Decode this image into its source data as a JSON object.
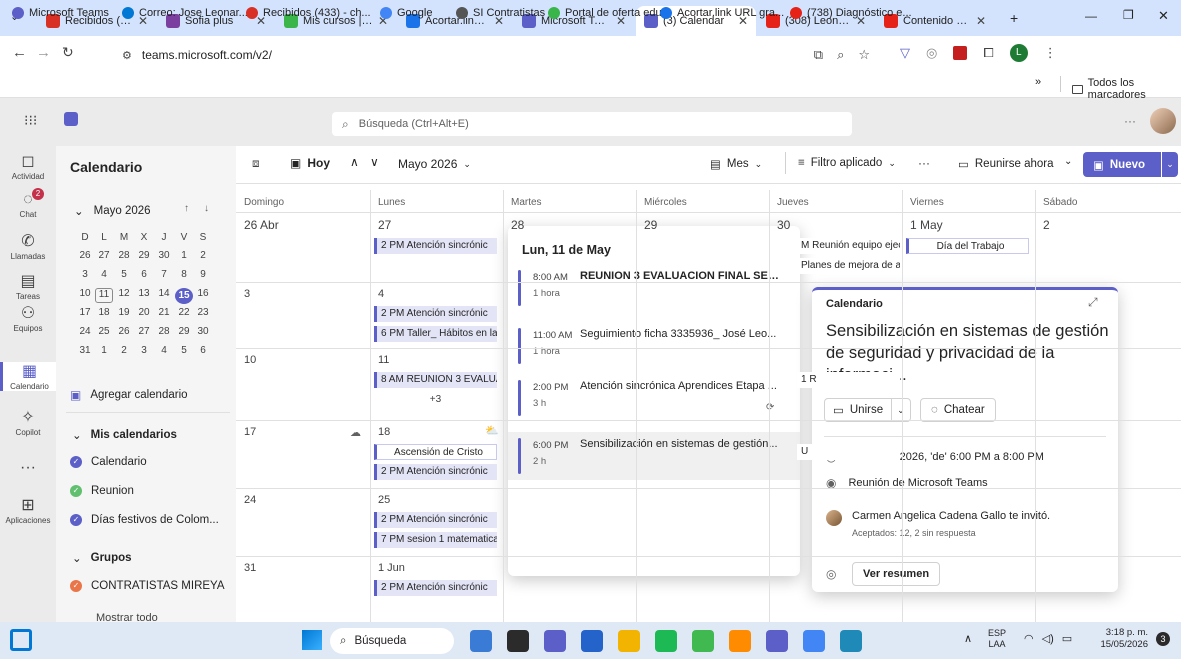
{
  "browser": {
    "tabs": [
      {
        "label": "Recibidos (3…",
        "color": "#d93025"
      },
      {
        "label": "Sofia plus",
        "color": "#7b3fa0"
      },
      {
        "label": "Mis cursos |…",
        "color": "#39b54a"
      },
      {
        "label": "Acortar.link…",
        "color": "#1a73e8"
      },
      {
        "label": "Microsoft Te…",
        "color": "#5b5fc7"
      },
      {
        "label": "(3) Calendar",
        "color": "#5b5fc7"
      },
      {
        "label": "(308) Leonar…",
        "color": "#e62117"
      },
      {
        "label": "Contenido d…",
        "color": "#e62117"
      }
    ],
    "new_tab": "+",
    "url": "teams.microsoft.com/v2/",
    "bookmarks": [
      {
        "label": "Microsoft Teams",
        "color": "#5b5fc7"
      },
      {
        "label": "Correo: Jose Leonar...",
        "color": "#0078d4"
      },
      {
        "label": "Recibidos (433) - ch...",
        "color": "#d93025"
      },
      {
        "label": "Google",
        "color": "#4285f4"
      },
      {
        "label": "SI Contratistas",
        "color": "#555555"
      },
      {
        "label": "Portal de oferta edu...",
        "color": "#39b54a"
      },
      {
        "label": "Acortar.link URL gra...",
        "color": "#1a73e8"
      },
      {
        "label": "(738) Diagnóstico e...",
        "color": "#e62117"
      }
    ],
    "bookmarks_more": "»",
    "all_bookmarks": "Todos los marcadores"
  },
  "teams": {
    "search_placeholder": "Búsqueda (Ctrl+Alt+E)",
    "more": "···",
    "rail": [
      {
        "label": "Actividad",
        "icon": "bell-icon"
      },
      {
        "label": "Chat",
        "icon": "chat-icon",
        "badge": "2"
      },
      {
        "label": "Llamadas",
        "icon": "phone-icon"
      },
      {
        "label": "Tareas",
        "icon": "tasks-icon"
      },
      {
        "label": "Equipos",
        "icon": "teams-icon"
      },
      {
        "label": "Calendario",
        "icon": "calendar-icon"
      },
      {
        "label": "Copilot",
        "icon": "copilot-icon"
      },
      {
        "label": "···",
        "icon": "more-icon"
      },
      {
        "label": "Aplicaciones",
        "icon": "apps-icon"
      }
    ]
  },
  "leftpanel": {
    "title": "Calendario",
    "month": "Mayo 2026",
    "weekdays": [
      "D",
      "L",
      "M",
      "X",
      "J",
      "V",
      "S"
    ],
    "weeks": [
      [
        "26",
        "27",
        "28",
        "29",
        "30",
        "1",
        "2"
      ],
      [
        "3",
        "4",
        "5",
        "6",
        "7",
        "8",
        "9"
      ],
      [
        "10",
        "11",
        "12",
        "13",
        "14",
        "15",
        "16"
      ],
      [
        "17",
        "18",
        "19",
        "20",
        "21",
        "22",
        "23"
      ],
      [
        "24",
        "25",
        "26",
        "27",
        "28",
        "29",
        "30"
      ],
      [
        "31",
        "1",
        "2",
        "3",
        "4",
        "5",
        "6"
      ]
    ],
    "add_calendar": "Agregar calendario",
    "my_calendars": "Mis calendarios",
    "calendars": [
      {
        "label": "Calendario",
        "color": "#5b5fc7"
      },
      {
        "label": "Reunion",
        "color": "#61c06f"
      },
      {
        "label": "Días festivos de Colom...",
        "color": "#5b5fc7"
      }
    ],
    "groups": "Grupos",
    "group_items": [
      {
        "label": "CONTRATISTAS MIREYA",
        "color": "#e97548"
      }
    ],
    "show_all": "Mostrar todo"
  },
  "cmdbar": {
    "today": "Hoy",
    "month_label": "Mayo 2026",
    "view": "Mes",
    "filter": "Filtro aplicado",
    "more": "···",
    "meet_now": "Reunirse ahora",
    "new": "Nuevo"
  },
  "grid": {
    "days": [
      "Domingo",
      "Lunes",
      "Martes",
      "Miércoles",
      "Jueves",
      "Viernes",
      "Sábado"
    ],
    "rows": [
      {
        "nums": [
          "26 Abr",
          "27",
          "28",
          "29",
          "30",
          "1 May",
          "2"
        ],
        "events": [
          {
            "col": 1,
            "slot": 0,
            "text": "2 PM Atención sincrónic"
          },
          {
            "col": 4,
            "slot": 0,
            "text": "M Reunión equipo ejec"
          },
          {
            "col": 4,
            "slot": 1,
            "text": "Planes de mejora de a"
          },
          {
            "col": 5,
            "slot": 0,
            "text": "Día del Trabajo",
            "allday": true
          }
        ]
      },
      {
        "nums": [
          "3",
          "4",
          "",
          "",
          "",
          "",
          ""
        ],
        "events": [
          {
            "col": 1,
            "slot": 0,
            "text": "2 PM Atención sincrónic"
          },
          {
            "col": 1,
            "slot": 1,
            "text": "6 PM Taller_ Hábitos en la F"
          }
        ]
      },
      {
        "nums": [
          "10",
          "11",
          "",
          "",
          "",
          "",
          ""
        ],
        "events": [
          {
            "col": 1,
            "slot": 0,
            "text": "8 AM REUNION 3 EVALUAC"
          },
          {
            "col": 4,
            "slot": 0,
            "text": "1 R"
          }
        ],
        "more": "+3"
      },
      {
        "nums": [
          "17",
          "18",
          "",
          "",
          "",
          "",
          ""
        ],
        "events": [
          {
            "col": 1,
            "slot": 0,
            "text": "Ascensión de Cristo",
            "allday": true
          },
          {
            "col": 1,
            "slot": 1,
            "text": "2 PM Atención sincrónic"
          },
          {
            "col": 4,
            "slot": 0,
            "text": "U"
          }
        ]
      },
      {
        "nums": [
          "24",
          "25",
          "",
          "",
          "",
          "",
          ""
        ],
        "events": [
          {
            "col": 1,
            "slot": 0,
            "text": "2 PM Atención sincrónic"
          },
          {
            "col": 1,
            "slot": 1,
            "text": "7 PM sesion 1 matematicas"
          }
        ]
      },
      {
        "nums": [
          "31",
          "1 Jun",
          "",
          "",
          "",
          "",
          ""
        ],
        "events": [
          {
            "col": 1,
            "slot": 0,
            "text": "2 PM Atención sincrónic"
          }
        ]
      }
    ]
  },
  "daypopup": {
    "title": "Lun, 11 de May",
    "events": [
      {
        "time": "8:00 AM",
        "dur": "1 hora",
        "subject": "REUNION 3 EVALUACION FINAL SEGU..."
      },
      {
        "time": "11:00 AM",
        "dur": "1 hora",
        "subject": "Seguimiento ficha 3335936_ José Leo..."
      },
      {
        "time": "2:00 PM",
        "dur": "3 h",
        "subject": "Atención sincrónica Aprendices Etapa ..."
      },
      {
        "time": "6:00 PM",
        "dur": "2 h",
        "subject": "Sensibilización en sistemas de gestión..."
      }
    ]
  },
  "detail": {
    "calendar": "Calendario",
    "title": "Sensibilización en sistemas de gestión de seguridad y privacidad de la informaci...",
    "join": "Unirse",
    "chat": "Chatear",
    "when": "Lun 11/05/2026, 'de' 6:00 PM a 8:00 PM",
    "where": "Reunión de Microsoft Teams",
    "organizer": "Carmen Angelica Cadena Gallo te invitó.",
    "responses": "Aceptados: 12, 2 sin respuesta",
    "summary": "Ver resumen"
  },
  "taskbar": {
    "search": "Búsqueda",
    "lang": "ESP",
    "lang2": "LAA",
    "time": "3:18 p. m.",
    "date": "15/05/2026",
    "badge": "3"
  },
  "colors": {
    "accent": "#5b5fc7",
    "event_bg": "#e3e5f7"
  }
}
